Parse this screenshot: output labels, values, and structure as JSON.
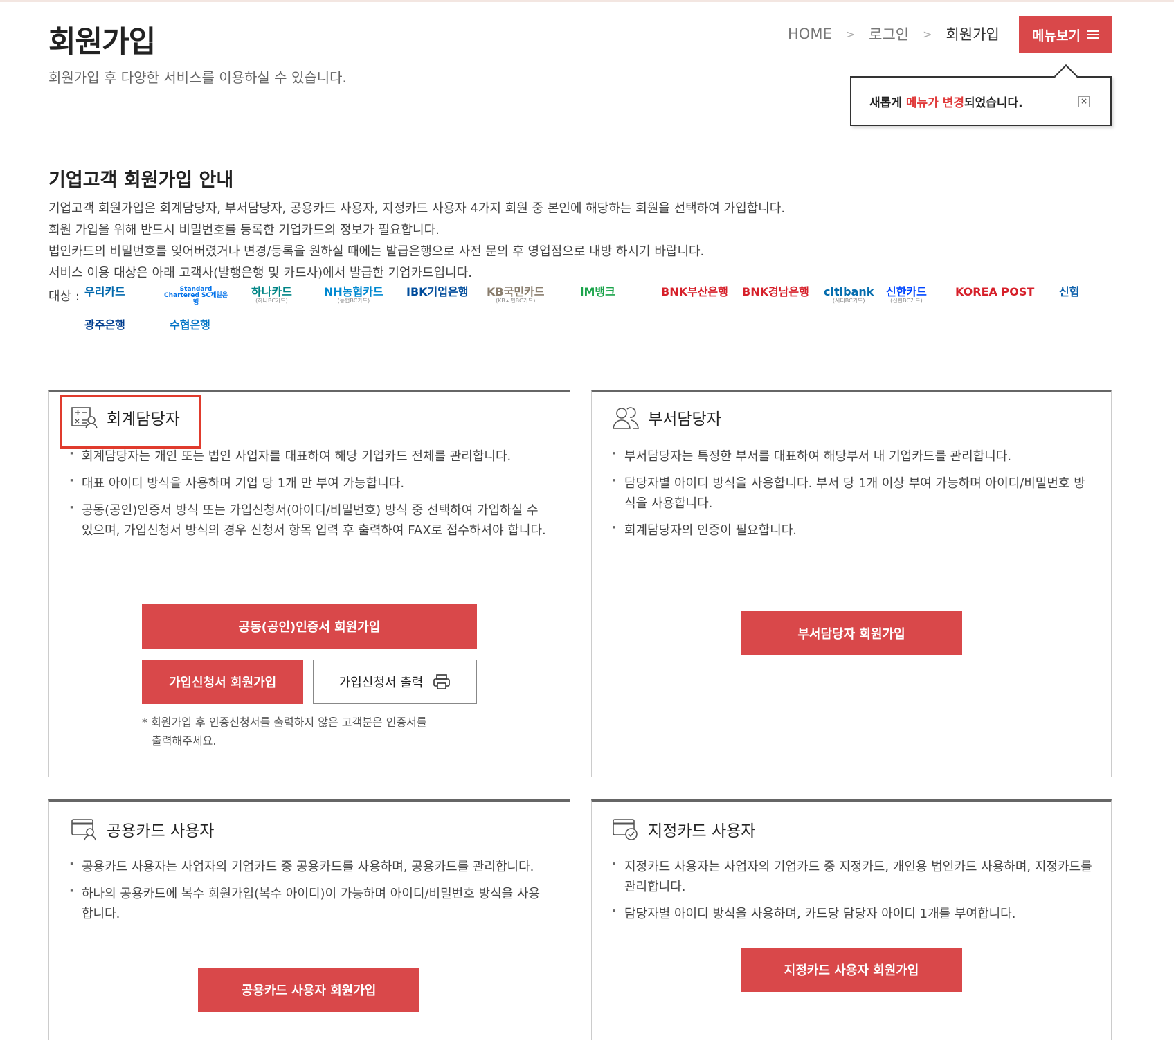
{
  "header": {
    "title": "회원가입",
    "subtitle": "회원가입 후 다양한 서비스를 이용하실 수 있습니다.",
    "breadcrumb": [
      "HOME",
      "로그인",
      "회원가입"
    ],
    "menu_label": "메뉴보기"
  },
  "notice": {
    "prefix": "새롭게 ",
    "highlight1": "메뉴가",
    "space": " ",
    "highlight2": "변경",
    "suffix": "되었습니다.",
    "close": "×"
  },
  "guide": {
    "title": "기업고객 회원가입 안내",
    "lines": [
      "기업고객 회원가입은 회계담당자, 부서담당자, 공용카드 사용자, 지정카드 사용자 4가지 회원 중 본인에 해당하는 회원을 선택하여 가입합니다.",
      "회원 가입을 위해 반드시 비밀번호를 등록한 기업카드의 정보가 필요합니다.",
      "법인카드의 비밀번호를 잊어버렸거나 변경/등록을 원하실 때에는 발급은행으로 사전 문의 후 영업점으로 내방 하시기 바랍니다.",
      "서비스 이용 대상은 아래 고객사(발행은행 및 카드사)에서 발급한 기업카드입니다."
    ],
    "target_label": "대상 :",
    "logos": [
      {
        "name": "우리카드",
        "sub": "",
        "color": "#0067ac"
      },
      {
        "name": "Standard Chartered SC제일은행",
        "sub": "",
        "color": "#0473ea"
      },
      {
        "name": "하나카드",
        "sub": "(하나BC카드)",
        "color": "#008485"
      },
      {
        "name": "NH농협카드",
        "sub": "(농협BC카드)",
        "color": "#0088d0"
      },
      {
        "name": "IBK기업은행",
        "sub": "",
        "color": "#004c9b"
      },
      {
        "name": "KB국민카드",
        "sub": "(KB국민BC카드)",
        "color": "#8a7e6e"
      },
      {
        "name": "iM뱅크",
        "sub": "",
        "color": "#1aa34a"
      },
      {
        "name": "BNK부산은행",
        "sub": "",
        "color": "#d6202a"
      },
      {
        "name": "BNK경남은행",
        "sub": "",
        "color": "#d6202a"
      },
      {
        "name": "citibank",
        "sub": "(시티BC카드)",
        "color": "#056dae"
      },
      {
        "name": "신한카드",
        "sub": "(신한BC카드)",
        "color": "#0046ff"
      },
      {
        "name": "KOREA POST",
        "sub": "",
        "color": "#d6202a"
      },
      {
        "name": "신협",
        "sub": "",
        "color": "#0b5fab"
      },
      {
        "name": "광주은행",
        "sub": "",
        "color": "#003d8f"
      },
      {
        "name": "수협은행",
        "sub": "",
        "color": "#0073c6"
      }
    ]
  },
  "cards": {
    "accountant": {
      "title": "회계담당자",
      "bullets": [
        "회계담당자는 개인 또는 법인 사업자를 대표하여 해당 기업카드 전체를 관리합니다.",
        "대표 아이디 방식을 사용하며 기업 당 1개 만 부여 가능합니다.",
        "공동(공인)인증서 방식 또는 가입신청서(아이디/비밀번호) 방식 중 선택하여 가입하실 수 있으며, 가입신청서 방식의 경우 신청서 항목 입력 후 출력하여 FAX로 접수하셔야 합니다."
      ],
      "btn_cert": "공동(공인)인증서 회원가입",
      "btn_form": "가입신청서 회원가입",
      "btn_print": "가입신청서 출력",
      "footnote_line1": "* 회원가입 후 인증신청서를 출력하지 않은 고객분은 인증서를",
      "footnote_line2": "출력해주세요."
    },
    "department": {
      "title": "부서담당자",
      "bullets": [
        "부서담당자는 특정한 부서를 대표하여 해당부서 내 기업카드를 관리합니다.",
        "담당자별 아이디 방식을 사용합니다. 부서 당 1개 이상 부여 가능하며 아이디/비밀번호 방식을 사용합니다.",
        "회계담당자의 인증이 필요합니다."
      ],
      "btn": "부서담당자 회원가입"
    },
    "shared": {
      "title": "공용카드 사용자",
      "bullets": [
        "공용카드 사용자는 사업자의 기업카드 중 공용카드를 사용하며, 공용카드를 관리합니다.",
        "하나의 공용카드에 복수 회원가입(복수 아이디)이 가능하며 아이디/비밀번호 방식을 사용합니다."
      ],
      "btn": "공용카드 사용자 회원가입"
    },
    "designated": {
      "title": "지정카드 사용자",
      "bullets": [
        "지정카드 사용자는 사업자의 기업카드 중 지정카드, 개인용 법인카드 사용하며, 지정카드를 관리합니다.",
        "담당자별 아이디 방식을 사용하며, 카드당 담당자 아이디 1개를 부여합니다."
      ],
      "btn": "지정카드 사용자 회원가입"
    }
  },
  "colors": {
    "accent": "#d9484a",
    "highlight_border": "#e03b2d"
  }
}
